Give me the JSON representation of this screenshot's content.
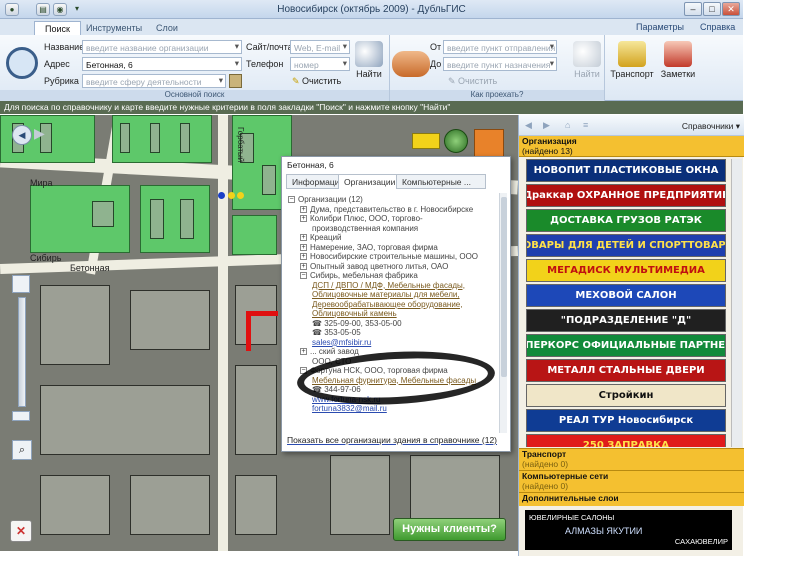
{
  "window": {
    "title": "Новосибирск (октябрь 2009) - ДубльГИС"
  },
  "tabs": [
    {
      "label": "Поиск"
    },
    {
      "label": "Инструменты"
    },
    {
      "label": "Слои"
    }
  ],
  "top_links": {
    "params": "Параметры",
    "help": "Справка"
  },
  "search_group": {
    "caption": "Основной поиск",
    "name_label": "Название",
    "name_placeholder": "введите название организации",
    "address_label": "Адрес",
    "address_value": "Бетонная, 6",
    "rubric_label": "Рубрика",
    "rubric_placeholder": "введите сферу деятельности",
    "site_label": "Сайт/почта",
    "site_placeholder": "Web, E-mail",
    "phone_label": "Телефон",
    "phone_placeholder": "номер",
    "clear_label": "Очистить",
    "find_label": "Найти"
  },
  "route_group": {
    "caption": "Как проехать?",
    "from_label": "От",
    "from_placeholder": "введите пункт отправления",
    "to_label": "До",
    "to_placeholder": "введите пункт назначения",
    "clear_label": "Очистить",
    "find_label": "Найти"
  },
  "big_buttons": {
    "transport": "Транспорт",
    "notes": "Заметки"
  },
  "info_bar": "Для поиска по справочнику и карте введите нужные критерии в поля закладки \"Поиск\" и нажмите кнопку \"Найти\"",
  "map_labels": {
    "street1": "Мира",
    "street2": "Сибирь",
    "street3": "Бетонная",
    "street4": "Горбатый"
  },
  "popup": {
    "title": "Бетонная, 6",
    "tabs": [
      "Информация",
      "Организации",
      "Компьютерные ..."
    ],
    "tree": [
      {
        "kind": "root",
        "text": "Организации (12)"
      },
      {
        "kind": "item",
        "text": "Дума, представительство в г. Новосибирске"
      },
      {
        "kind": "item",
        "text": "Колибри Плюс, ООО, торгово-"
      },
      {
        "kind": "cont",
        "text": "производственная компания"
      },
      {
        "kind": "item",
        "text": "Креаций"
      },
      {
        "kind": "item",
        "text": "Намерение, ЗАО, торговая фирма"
      },
      {
        "kind": "item",
        "text": "Новосибирские строительные машины, ООО"
      },
      {
        "kind": "item",
        "text": "Опытный завод цветного литья, ОАО"
      },
      {
        "kind": "open",
        "text": "Сибирь, мебельная фабрика"
      },
      {
        "kind": "link",
        "text": "ДСП / ДВПО / МДФ, Мебельные фасады,"
      },
      {
        "kind": "link",
        "text": "Облицовочные материалы для мебели,"
      },
      {
        "kind": "link",
        "text": "Деревообрабатывающее оборудование,"
      },
      {
        "kind": "link",
        "text": "Облицовочный камень"
      },
      {
        "kind": "phone",
        "text": "325-09-00, 353-05-00"
      },
      {
        "kind": "phone",
        "text": "353-05-05"
      },
      {
        "kind": "email",
        "text": "sales@mfsibir.ru"
      },
      {
        "kind": "item",
        "text": "... ский завод"
      },
      {
        "kind": "cont",
        "text": "ООО, СТО"
      },
      {
        "kind": "open",
        "text": "Фортуна НСК, ООО, торговая фирма"
      },
      {
        "kind": "link",
        "text": "Мебельная фурнитура, Мебельные фасады"
      },
      {
        "kind": "phone",
        "text": "344-97-06"
      },
      {
        "kind": "email",
        "text": "www.fortuna-nsk.ru"
      },
      {
        "kind": "email",
        "text": "fortuna3832@mail.ru"
      }
    ],
    "footer_link": "Показать все организации здания в справочнике",
    "footer_count": "(12)"
  },
  "right_panel": {
    "dropdown": "Справочники",
    "org_header": "Организация",
    "org_found": "(найдено 13)",
    "banners": [
      {
        "text": "НОВОПИТ  ПЛАСТИКОВЫЕ ОКНА",
        "bg": "#0a2f7a",
        "fg": "#ffffff"
      },
      {
        "text": "Драккар ОХРАННОЕ ПРЕДПРИЯТИЕ",
        "bg": "#b01010",
        "fg": "#ffffff"
      },
      {
        "text": "ДОСТАВКА ГРУЗОВ  РАТЭК",
        "bg": "#1a8a2a",
        "fg": "#ffffff"
      },
      {
        "text": "ТОВАРЫ ДЛЯ ДЕТЕЙ И СПОРТТОВАРЫ",
        "bg": "#1f3fae",
        "fg": "#ffe14a"
      },
      {
        "text": "МЕГАДИСК  МУЛЬТИМЕДИА",
        "bg": "#f2d21a",
        "fg": "#c01010"
      },
      {
        "text": "МЕХОВОЙ САЛОН",
        "bg": "#1d48b8",
        "fg": "#ffffff"
      },
      {
        "text": "\"ПОДРАЗДЕЛЕНИЕ \"Д\"",
        "bg": "#202020",
        "fg": "#ffffff"
      },
      {
        "text": "КАПЕРКОРС  ОФИЦИАЛЬНЫЕ ПАРТНЕРЫ",
        "bg": "#128a3a",
        "fg": "#ffffff"
      },
      {
        "text": "МЕТАЛЛ  СТАЛЬНЫЕ ДВЕРИ",
        "bg": "#b81515",
        "fg": "#ffffff"
      },
      {
        "text": "Стройкин",
        "bg": "#f0e6c8",
        "fg": "#111111"
      },
      {
        "text": "РЕАЛ ТУР Новосибирск",
        "bg": "#0f3c94",
        "fg": "#ffffff"
      },
      {
        "text": "250  ЗАПРАВКА",
        "bg": "#e01b1b",
        "fg": "#ffe14a"
      }
    ],
    "sections": [
      {
        "title": "Транспорт",
        "count": "(найдено 0)"
      },
      {
        "title": "Компьютерные сети",
        "count": "(найдено 0)"
      },
      {
        "title": "Дополнительные слои",
        "count": ""
      }
    ],
    "ad": {
      "left": "ЮВЕЛИРНЫЕ САЛОНЫ",
      "brand": "АЛМАЗЫ ЯКУТИИ",
      "right": "САХАЮВЕЛИР"
    }
  },
  "map_button": "Нужны клиенты?"
}
